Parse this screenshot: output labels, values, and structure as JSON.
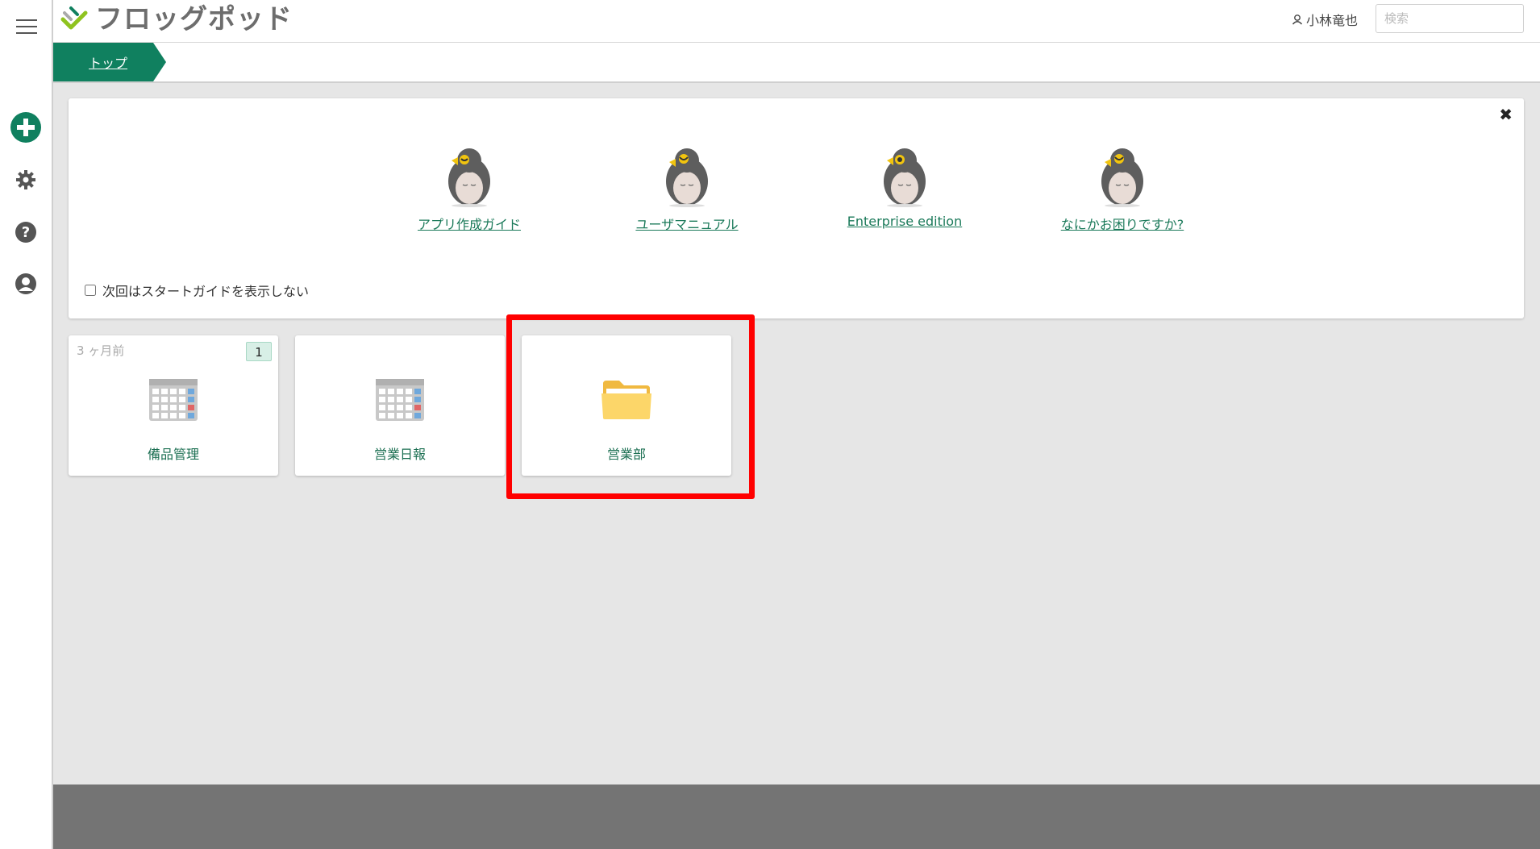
{
  "header": {
    "logo_text": "フロッグポッド",
    "user_name": "小林竜也",
    "search_placeholder": "検索"
  },
  "breadcrumb": {
    "label": "トップ"
  },
  "guide": {
    "items": [
      {
        "label": "アプリ作成ガイド"
      },
      {
        "label": "ユーザマニュアル"
      },
      {
        "label": "Enterprise edition"
      },
      {
        "label": "なにかお困りですか?"
      }
    ],
    "checkbox_label": "次回はスタートガイドを表示しない"
  },
  "tiles": [
    {
      "label": "備品管理",
      "time_ago": "3 ヶ月前",
      "badge": "1",
      "icon": "calendar-app-icon"
    },
    {
      "label": "営業日報",
      "icon": "calendar-app-icon"
    },
    {
      "label": "営業部",
      "icon": "folder-icon"
    }
  ],
  "colors": {
    "brand_green": "#10805f",
    "link_green": "#1b7a5a",
    "highlight_red": "#ff0000",
    "footer_gray": "#747474"
  }
}
